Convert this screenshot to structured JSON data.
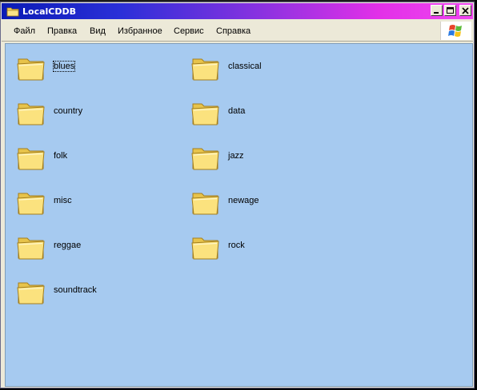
{
  "window": {
    "title": "LocalCDDB",
    "icon": "folder-icon"
  },
  "menu": [
    {
      "label": "Файл"
    },
    {
      "label": "Правка"
    },
    {
      "label": "Вид"
    },
    {
      "label": "Избранное"
    },
    {
      "label": "Сервис"
    },
    {
      "label": "Справка"
    }
  ],
  "folders": [
    {
      "name": "blues",
      "selected": true
    },
    {
      "name": "classical"
    },
    {
      "name": "country"
    },
    {
      "name": "data"
    },
    {
      "name": "folk"
    },
    {
      "name": "jazz"
    },
    {
      "name": "misc"
    },
    {
      "name": "newage"
    },
    {
      "name": "reggae"
    },
    {
      "name": "rock"
    },
    {
      "name": "soundtrack"
    }
  ],
  "colors": {
    "content_bg": "#a6caf0",
    "folder": "#f5d560"
  }
}
